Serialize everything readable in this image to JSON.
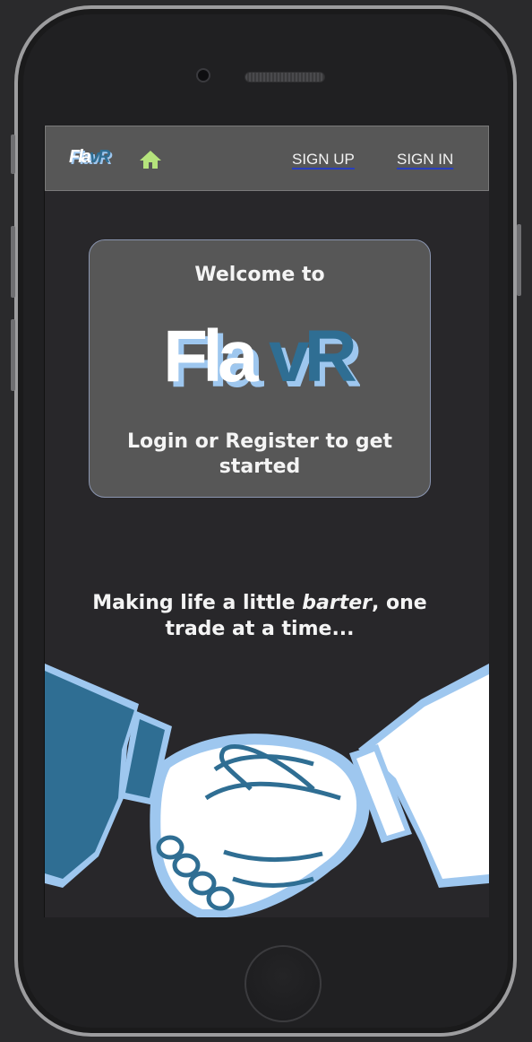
{
  "navbar": {
    "logo_text_a": "Fla",
    "logo_text_b": "vR",
    "home_icon": "home-icon",
    "signup_label": "SIGN UP",
    "signin_label": "SIGN IN"
  },
  "welcome": {
    "title": "Welcome to",
    "logo_text_a": "Fla",
    "logo_text_b": "vR",
    "subtitle": "Login or Register to get started"
  },
  "tagline": {
    "before": "Making life a little ",
    "emphasis": "barter",
    "after": ", one trade at a time..."
  },
  "illustration": "handshake-illustration",
  "colors": {
    "background": "#28272a",
    "navbar": "#575757",
    "card": "#575757",
    "brand_blue": "#2f6e93",
    "light_blue": "#9ec7ef",
    "home_icon_green": "#b5e37c",
    "link_underline": "#2a3fbf"
  }
}
